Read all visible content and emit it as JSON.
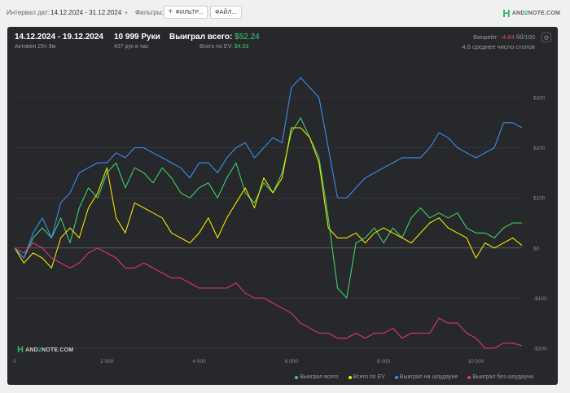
{
  "topbar": {
    "interval_label": "Интервал дат:",
    "interval_value": "14.12.2024 - 31.12.2024",
    "filters_label": "Фильтры:",
    "filters_button": "ФИЛЬТР...",
    "files_button": "ФАЙЛ...",
    "brand": {
      "h": "H",
      "pre": "AND",
      "two": "2",
      "post": "NOTE.COM"
    }
  },
  "summary": {
    "period": "14.12.2024 - 19.12.2024",
    "active": "Активен 25ч 9м",
    "hands": "10 999 Руки",
    "hands_rate": "437 рук в час",
    "won_total_label": "Выиграл всего:",
    "won_total_value": "$52.24",
    "ev_label": "Всего по EV:",
    "ev_value": "$4.53",
    "winrate_label": "Винрейт:",
    "winrate_value": "-4.64",
    "winrate_tail": "бб/100",
    "tables": "4.6 среднее число столов"
  },
  "chart_data": {
    "type": "line",
    "xlabel": "",
    "ylabel": "",
    "x_ticks": [
      "0",
      "2 000",
      "4 000",
      "6 000",
      "8 000",
      "10 000"
    ],
    "y_ticks": [
      "$300",
      "$200",
      "$100",
      "$0",
      "-$100",
      "-$200"
    ],
    "xlim": [
      0,
      10999
    ],
    "ylim": [
      -205,
      365
    ],
    "series": [
      {
        "name": "Выиграл всего",
        "color": "#3ecf6c",
        "x": [
          0,
          200,
          400,
          600,
          800,
          1000,
          1200,
          1400,
          1600,
          1800,
          2000,
          2200,
          2400,
          2600,
          2800,
          3000,
          3200,
          3400,
          3600,
          3800,
          4000,
          4200,
          4400,
          4600,
          4800,
          5000,
          5200,
          5400,
          5600,
          5800,
          6000,
          6200,
          6400,
          6600,
          6800,
          7000,
          7200,
          7400,
          7600,
          7800,
          8000,
          8200,
          8400,
          8600,
          8800,
          9000,
          9200,
          9400,
          9600,
          9800,
          10000,
          10200,
          10400,
          10600,
          10800,
          10999
        ],
        "values": [
          0,
          -20,
          20,
          40,
          20,
          60,
          10,
          80,
          120,
          100,
          150,
          170,
          120,
          160,
          150,
          130,
          160,
          140,
          110,
          100,
          120,
          130,
          100,
          140,
          170,
          110,
          90,
          130,
          110,
          150,
          230,
          260,
          220,
          180,
          60,
          -80,
          -100,
          10,
          20,
          40,
          10,
          40,
          20,
          60,
          80,
          60,
          70,
          60,
          70,
          40,
          30,
          30,
          20,
          40,
          50,
          50
        ]
      },
      {
        "name": "Всего по EV",
        "color": "#f2e500",
        "x": [
          0,
          200,
          400,
          600,
          800,
          1000,
          1200,
          1400,
          1600,
          1800,
          2000,
          2200,
          2400,
          2600,
          2800,
          3000,
          3200,
          3400,
          3600,
          3800,
          4000,
          4200,
          4400,
          4600,
          4800,
          5000,
          5200,
          5400,
          5600,
          5800,
          6000,
          6200,
          6400,
          6600,
          6800,
          7000,
          7200,
          7400,
          7600,
          7800,
          8000,
          8200,
          8400,
          8600,
          8800,
          9000,
          9200,
          9400,
          9600,
          9800,
          10000,
          10200,
          10400,
          10600,
          10800,
          10999
        ],
        "values": [
          0,
          -30,
          -10,
          -20,
          -40,
          20,
          40,
          20,
          80,
          110,
          160,
          60,
          30,
          90,
          80,
          70,
          60,
          30,
          20,
          10,
          30,
          60,
          20,
          60,
          90,
          120,
          80,
          140,
          110,
          140,
          240,
          240,
          220,
          170,
          40,
          20,
          20,
          30,
          10,
          30,
          40,
          30,
          20,
          10,
          30,
          50,
          60,
          40,
          30,
          20,
          -20,
          10,
          0,
          10,
          20,
          5
        ]
      },
      {
        "name": "Выиграл на шоудауне",
        "color": "#3b8ee8",
        "x": [
          0,
          200,
          400,
          600,
          800,
          1000,
          1200,
          1400,
          1600,
          1800,
          2000,
          2200,
          2400,
          2600,
          2800,
          3000,
          3200,
          3400,
          3600,
          3800,
          4000,
          4200,
          4400,
          4600,
          4800,
          5000,
          5200,
          5400,
          5600,
          5800,
          6000,
          6200,
          6400,
          6600,
          6800,
          7000,
          7200,
          7400,
          7600,
          7800,
          8000,
          8200,
          8400,
          8600,
          8800,
          9000,
          9200,
          9400,
          9600,
          9800,
          10000,
          10200,
          10400,
          10600,
          10800,
          10999
        ],
        "values": [
          0,
          -20,
          30,
          60,
          20,
          90,
          110,
          150,
          160,
          170,
          170,
          190,
          180,
          200,
          200,
          190,
          180,
          170,
          160,
          140,
          170,
          170,
          150,
          180,
          200,
          210,
          180,
          200,
          220,
          210,
          320,
          340,
          320,
          300,
          200,
          100,
          100,
          120,
          140,
          150,
          160,
          170,
          180,
          180,
          180,
          200,
          230,
          220,
          200,
          190,
          180,
          190,
          200,
          250,
          250,
          240
        ]
      },
      {
        "name": "Выиграл без шоудауна",
        "color": "#e0366a",
        "x": [
          0,
          200,
          400,
          600,
          800,
          1000,
          1200,
          1400,
          1600,
          1800,
          2000,
          2200,
          2400,
          2600,
          2800,
          3000,
          3200,
          3400,
          3600,
          3800,
          4000,
          4200,
          4400,
          4600,
          4800,
          5000,
          5200,
          5400,
          5600,
          5800,
          6000,
          6200,
          6400,
          6600,
          6800,
          7000,
          7200,
          7400,
          7600,
          7800,
          8000,
          8200,
          8400,
          8600,
          8800,
          9000,
          9200,
          9400,
          9600,
          9800,
          10000,
          10200,
          10400,
          10600,
          10800,
          10999
        ],
        "values": [
          0,
          -10,
          10,
          0,
          -20,
          -30,
          -40,
          -30,
          -10,
          0,
          -10,
          -20,
          -40,
          -40,
          -30,
          -40,
          -50,
          -60,
          -60,
          -70,
          -80,
          -80,
          -80,
          -80,
          -70,
          -90,
          -100,
          -100,
          -110,
          -120,
          -130,
          -150,
          -160,
          -170,
          -170,
          -180,
          -180,
          -170,
          -180,
          -170,
          -170,
          -160,
          -180,
          -170,
          -170,
          -170,
          -140,
          -150,
          -150,
          -170,
          -180,
          -200,
          -200,
          -190,
          -190,
          -195
        ]
      }
    ]
  },
  "watermark": {
    "h": "H",
    "pre": "AND",
    "two": "2",
    "post": "NOTE.COM"
  }
}
